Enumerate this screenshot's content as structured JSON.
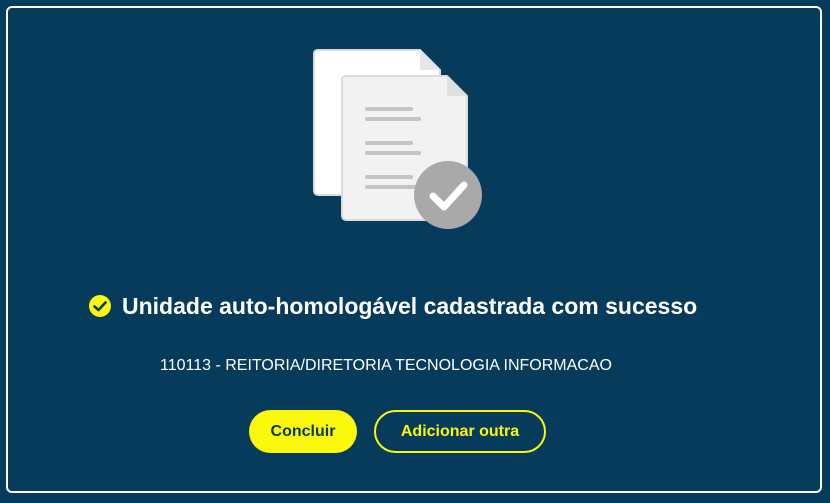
{
  "colors": {
    "background": "#073b5c",
    "accent": "#fcf80c",
    "text": "#ffffff"
  },
  "illustration": {
    "icon": "documents-approved-icon"
  },
  "success": {
    "icon": "check-circle-icon",
    "title": "Unidade auto-homologável cadastrada com sucesso"
  },
  "unit": {
    "text": "110113 - REITORIA/DIRETORIA TECNOLOGIA INFORMACAO"
  },
  "actions": {
    "conclude_label": "Concluir",
    "add_another_label": "Adicionar outra"
  }
}
